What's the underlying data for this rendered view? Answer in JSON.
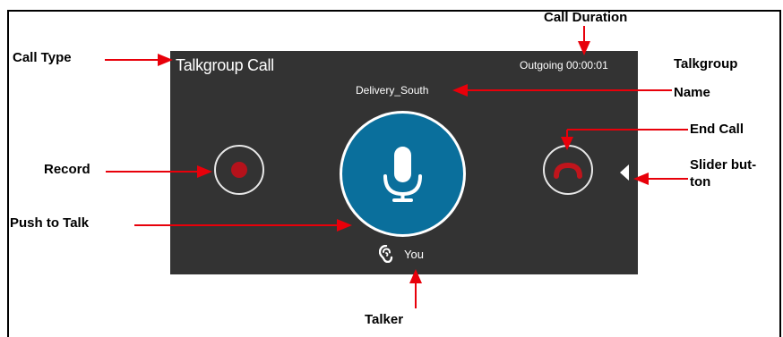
{
  "call": {
    "type": "Talkgroup Call",
    "duration": "Outgoing 00:00:01",
    "talkgroup_name": "Delivery_South",
    "talker": "You"
  },
  "controls": {
    "record_icon": "record-icon",
    "ptt_icon": "microphone-icon",
    "end_icon": "phone-hangup-icon",
    "slider_icon": "triangle-left-icon"
  },
  "annotations": {
    "call_type": "Call Type",
    "call_duration": "Call Duration",
    "talkgroup_line1": "Talkgroup",
    "talkgroup_line2": "Name",
    "end_call": "End Call",
    "record": "Record",
    "slider_line1": "Slider but-",
    "slider_line2": "ton",
    "push_to_talk": "Push to Talk",
    "talker": "Talker"
  },
  "colors": {
    "panel": "#333333",
    "ptt": "#0a6f9c",
    "accent_red": "#b5121b",
    "arrow": "#e8000a"
  }
}
